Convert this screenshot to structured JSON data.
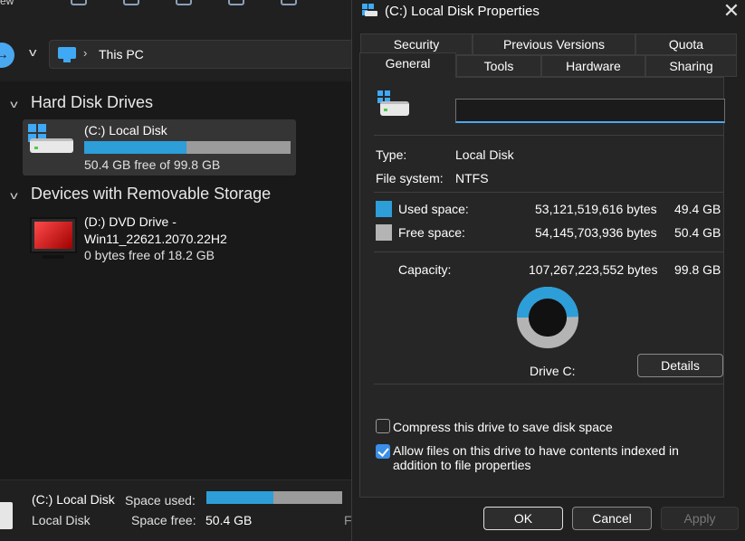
{
  "explorer": {
    "toolbar": {
      "label": "ew"
    },
    "address": {
      "path": "This PC",
      "separator": "›"
    },
    "groups": [
      {
        "label": "Hard Disk Drives"
      },
      {
        "label": "Devices with Removable Storage"
      }
    ],
    "drive_c": {
      "name": "(C:) Local Disk",
      "free_text": "50.4 GB free of 99.8 GB",
      "used_fraction": 0.495
    },
    "drive_d": {
      "name": "(D:) DVD Drive - Win11_22621.2070.22H2",
      "free_text": "0 bytes free of 18.2 GB"
    },
    "details": {
      "title": "(C:) Local Disk",
      "subtitle": "Local Disk",
      "space_used_label": "Space used:",
      "space_free_label": "Space free:",
      "space_free_value": "50.4 GB",
      "used_fraction": 0.495,
      "cut_text": "F"
    }
  },
  "dialog": {
    "title": "(C:) Local Disk Properties",
    "close_glyph": "✕",
    "tabs_row1": [
      "Security",
      "Previous Versions",
      "Quota"
    ],
    "tabs_row2": [
      "General",
      "Tools",
      "Hardware",
      "Sharing"
    ],
    "active_tab": "General",
    "name_value": "",
    "type_label": "Type:",
    "type_value": "Local Disk",
    "fs_label": "File system:",
    "fs_value": "NTFS",
    "used_label": "Used space:",
    "used_bytes": "53,121,519,616 bytes",
    "used_gb": "49.4 GB",
    "free_label": "Free space:",
    "free_bytes": "54,145,703,936 bytes",
    "free_gb": "50.4 GB",
    "capacity_label": "Capacity:",
    "capacity_bytes": "107,267,223,552 bytes",
    "capacity_gb": "99.8 GB",
    "drive_label": "Drive C:",
    "details_button": "Details",
    "compress_label": "Compress this drive to save disk space",
    "compress_checked": false,
    "index_label": "Allow files on this drive to have contents indexed in addition to file properties",
    "index_checked": true,
    "ok_label": "OK",
    "cancel_label": "Cancel",
    "apply_label": "Apply",
    "colors": {
      "used": "#2d9ed8",
      "free": "#b4b4b4"
    },
    "used_fraction": 0.495
  }
}
